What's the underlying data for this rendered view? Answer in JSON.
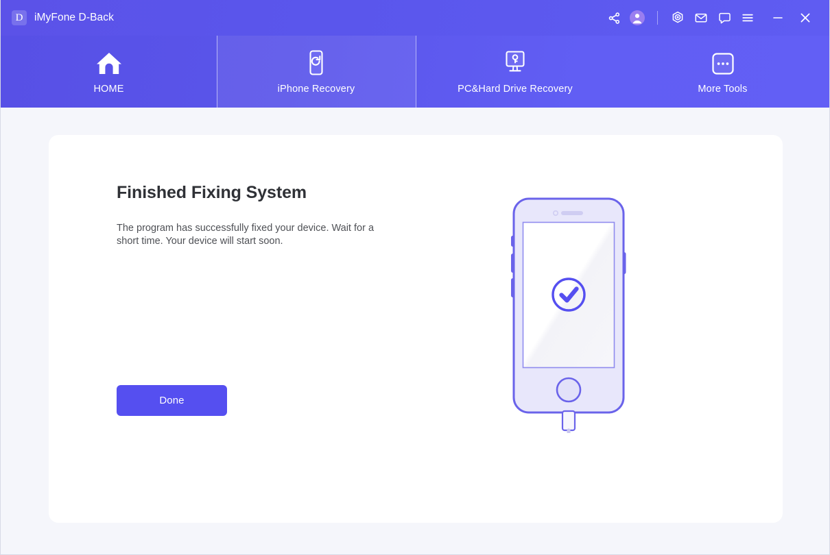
{
  "window": {
    "brand_logo_letter": "D",
    "title": "iMyFone D-Back",
    "accent_color": "#554ff0",
    "header_gradient_from": "#5750e6",
    "header_gradient_to": "#625ff5",
    "background_color": "#f5f6fb",
    "card_color": "#ffffff"
  },
  "title_bar": {
    "actions": [
      {
        "name": "share-icon",
        "label": "Share"
      },
      {
        "name": "account-icon",
        "label": "Account"
      },
      {
        "name": "divider",
        "label": ""
      },
      {
        "name": "target-icon",
        "label": "Activate"
      },
      {
        "name": "mail-icon",
        "label": "Feedback"
      },
      {
        "name": "chat-icon",
        "label": "Support"
      },
      {
        "name": "menu-icon",
        "label": "Menu"
      },
      {
        "name": "minimize-icon",
        "label": "Minimize"
      },
      {
        "name": "close-icon",
        "label": "Close"
      }
    ]
  },
  "nav": {
    "tabs": [
      {
        "id": "home",
        "label": "HOME",
        "icon": "home-icon",
        "active": false
      },
      {
        "id": "iphone",
        "label": "iPhone Recovery",
        "icon": "phone-refresh-icon",
        "active": true
      },
      {
        "id": "pc",
        "label": "PC&Hard Drive Recovery",
        "icon": "monitor-key-icon",
        "active": false
      },
      {
        "id": "more",
        "label": "More Tools",
        "icon": "more-dots-icon",
        "active": false
      }
    ]
  },
  "main": {
    "headline": "Finished Fixing System",
    "description": "The program has successfully fixed your device. Wait for a short time. Your device will start soon.",
    "primary_button": "Done",
    "illustration": {
      "name": "iphone-success-illustration",
      "status_icon": "check-circle-icon",
      "body_color": "#e8e7fb",
      "outline_color": "#6a63ea",
      "screen_color": "#ffffff",
      "cable": "lightning-cable"
    }
  }
}
